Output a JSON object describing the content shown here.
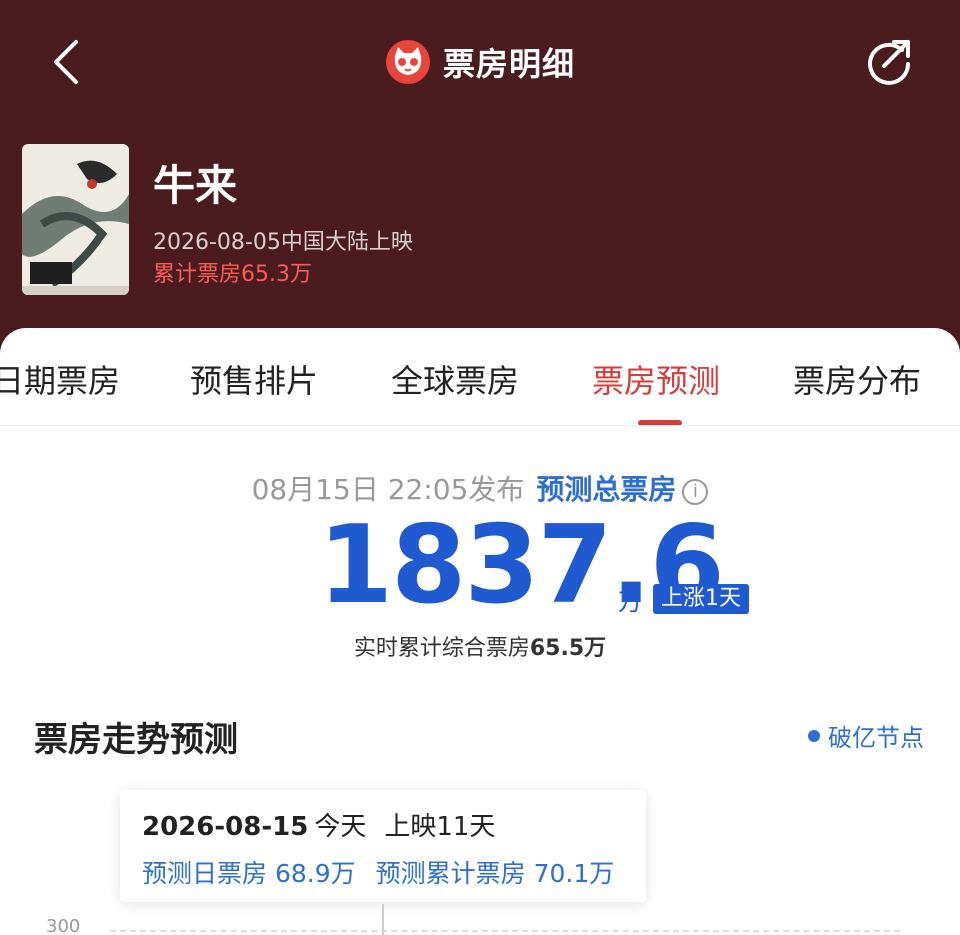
{
  "header": {
    "title": "票房明细",
    "back_icon": "chevron-left-icon",
    "share_icon": "share-icon",
    "logo_icon": "maoyan-cat-logo"
  },
  "movie": {
    "name": "牛来",
    "release": "2026-08-05中国大陆上映",
    "cumulative": "累计票房65.3万"
  },
  "tabs": [
    {
      "label": "日期票房",
      "active": false
    },
    {
      "label": "预售排片",
      "active": false
    },
    {
      "label": "全球票房",
      "active": false
    },
    {
      "label": "票房预测",
      "active": true
    },
    {
      "label": "票房分布",
      "active": false
    }
  ],
  "forecast": {
    "publish_time": "08月15日  22:05发布",
    "label": "预测总票房",
    "value": "1837.6",
    "unit": "万",
    "badge": "上涨1天",
    "realtime_prefix": "实时累计综合票房",
    "realtime_value": "65.5万"
  },
  "trend": {
    "title": "票房走势预测",
    "legend": "破亿节点"
  },
  "tooltip": {
    "date": "2026-08-15",
    "today": "今天",
    "days": "上映11天",
    "daily": "预测日票房 68.9万",
    "cumulative": "预测累计票房 70.1万"
  },
  "chart": {
    "y_tick": "300"
  },
  "colors": {
    "header_bg": "#4a1c1f",
    "accent_red": "#d93a3a",
    "accent_blue": "#1f5ad1"
  }
}
